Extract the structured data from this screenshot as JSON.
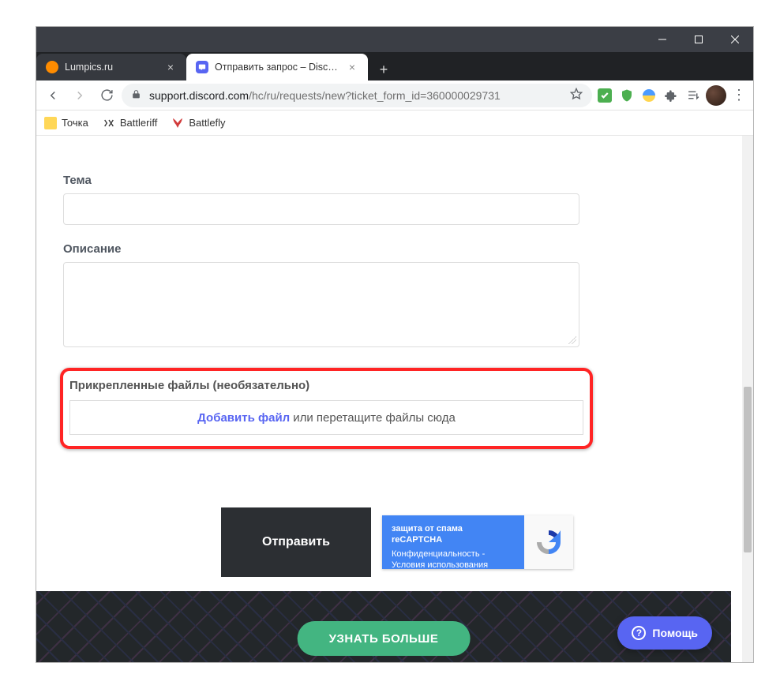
{
  "tabs": {
    "inactive": {
      "title": "Lumpics.ru"
    },
    "active": {
      "title": "Отправить запрос – Discord"
    }
  },
  "url": {
    "host": "support.discord.com",
    "path": "/hc/ru/requests/new?ticket_form_id=360000029731"
  },
  "bookmarks": {
    "b1": "Точка",
    "b2": "Battleriff",
    "b3": "Battlefly"
  },
  "form": {
    "topic_label": "Тема",
    "description_label": "Описание",
    "attachments_label": "Прикрепленные файлы (необязательно)",
    "add_file_link": "Добавить файл",
    "drag_hint": " или перетащите файлы сюда",
    "submit": "Отправить"
  },
  "recaptcha": {
    "title": "защита от спама reCAPTCHA",
    "privacy": "Конфиденциальность",
    "sep": " - ",
    "terms": "Условия использования"
  },
  "footer": {
    "learn_more": "УЗНАТЬ БОЛЬШЕ",
    "help": "Помощь"
  }
}
